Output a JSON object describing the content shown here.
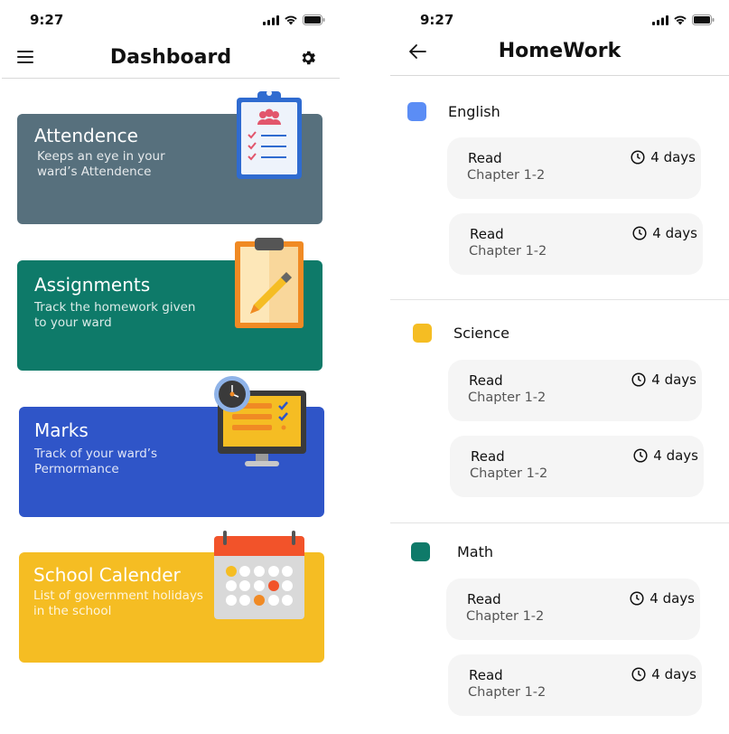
{
  "status_bar": {
    "time": "9:27"
  },
  "dashboard": {
    "title": "Dashboard",
    "cards": [
      {
        "title": "Attendence",
        "subtitle": "Keeps an eye in your ward’s Attendence",
        "color": "#57707d"
      },
      {
        "title": "Assignments",
        "subtitle": "Track the homework given to your ward",
        "color": "#0e7a69"
      },
      {
        "title": "Marks",
        "subtitle": "Track of your ward’s Permormance",
        "color": "#2f55c8"
      },
      {
        "title": "School Calender",
        "subtitle": "List of government holidays in the school",
        "color": "#f5bd23"
      }
    ]
  },
  "homework": {
    "title": "HomeWork",
    "subjects": [
      {
        "name": "English",
        "color": "#5b8df5",
        "items": [
          {
            "title": "Read",
            "subtitle": "Chapter 1-2",
            "due": "4 days"
          },
          {
            "title": "Read",
            "subtitle": "Chapter 1-2",
            "due": "4 days"
          }
        ]
      },
      {
        "name": "Science",
        "color": "#f5bd23",
        "items": [
          {
            "title": "Read",
            "subtitle": "Chapter 1-2",
            "due": "4 days"
          },
          {
            "title": "Read",
            "subtitle": "Chapter 1-2",
            "due": "4 days"
          }
        ]
      },
      {
        "name": "Math",
        "color": "#0e7a69",
        "items": [
          {
            "title": "Read",
            "subtitle": "Chapter 1-2",
            "due": "4 days"
          },
          {
            "title": "Read",
            "subtitle": "Chapter 1-2",
            "due": "4 days"
          }
        ]
      }
    ]
  }
}
